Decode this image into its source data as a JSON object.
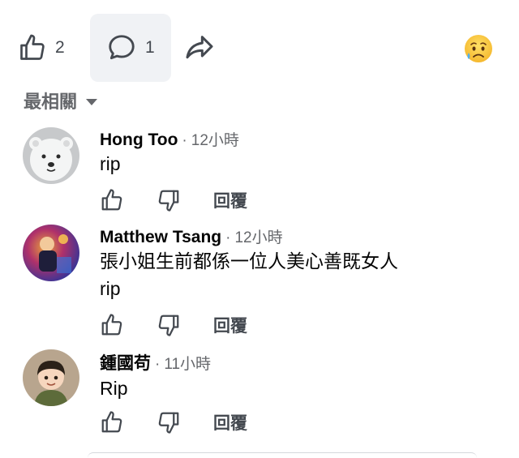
{
  "post_actions": {
    "like_count": "2",
    "comment_count": "1",
    "reaction_icon": "crying-face-icon"
  },
  "sort": {
    "label": "最相關"
  },
  "comments": [
    {
      "author": "Hong Too",
      "time": "12小時",
      "lines": [
        "rip"
      ],
      "avatar": "polar-bear-avatar",
      "reply_label": "回覆"
    },
    {
      "author": "Matthew Tsang",
      "time": "12小時",
      "lines": [
        "張小姐生前都係一位人美心善既女人",
        "rip"
      ],
      "avatar": "colorful-photo-avatar",
      "reply_label": "回覆"
    },
    {
      "author": "鍾國苟",
      "time": "11小時",
      "lines": [
        "Rip"
      ],
      "avatar": "cartoon-person-avatar",
      "reply_label": "回覆"
    }
  ],
  "separator": "·",
  "colors": {
    "muted": "#65676b",
    "button_bg": "#f0f2f5",
    "text": "#050505"
  }
}
